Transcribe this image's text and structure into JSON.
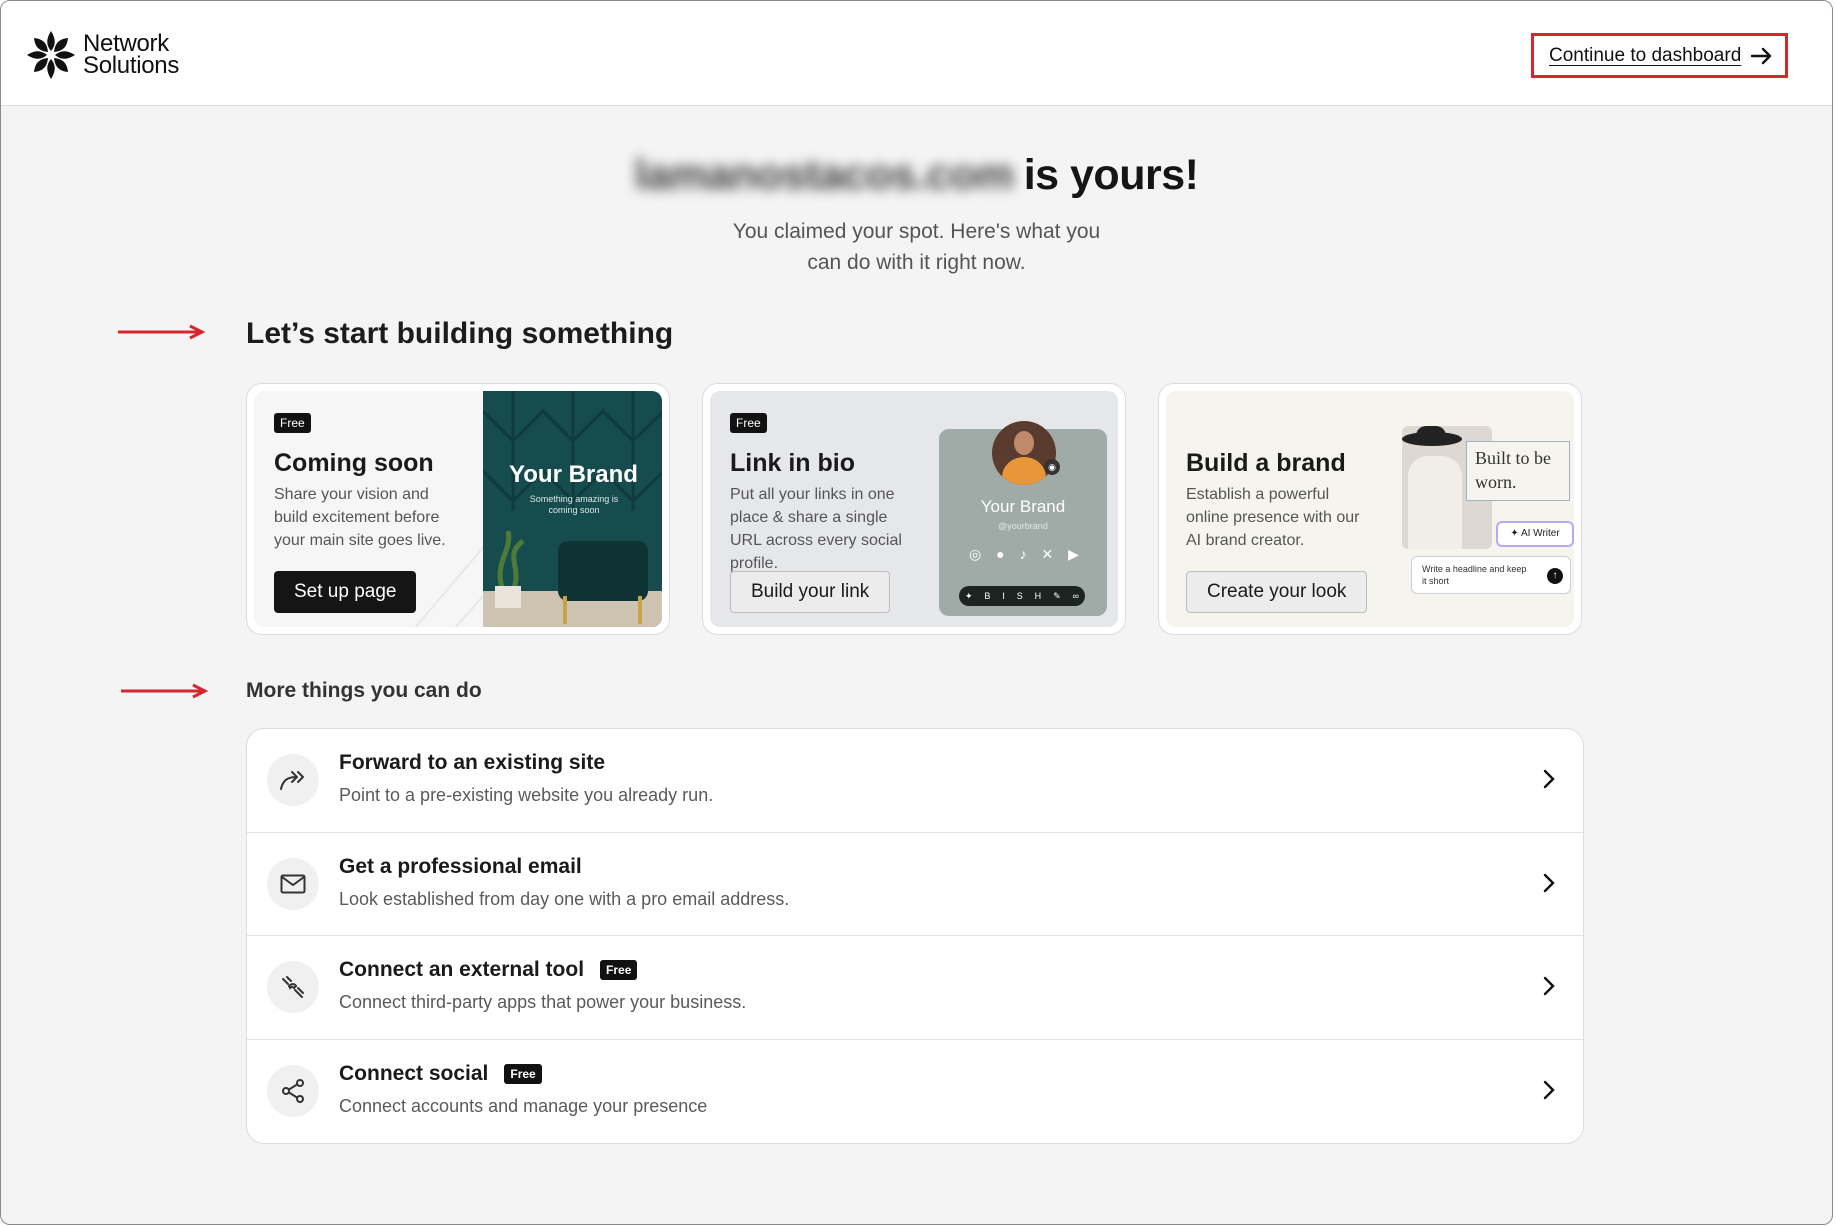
{
  "header": {
    "logo_line1": "Network",
    "logo_line2": "Solutions",
    "continue_label": "Continue to dashboard"
  },
  "hero": {
    "domain": "lamanostacos.com",
    "title_suffix": "is yours!",
    "subtitle": "You claimed your spot. Here's what you can do with it right now."
  },
  "build_section": {
    "title": "Let’s start building something",
    "cards": [
      {
        "badge": "Free",
        "title": "Coming soon",
        "description": "Share your vision and build excitement before your main site goes live.",
        "button": "Set up page",
        "preview_title": "Your Brand",
        "preview_sub": "Something amazing is coming soon"
      },
      {
        "badge": "Free",
        "title": "Link in bio",
        "description": "Put all your links in one place & share a single URL across every social profile.",
        "button": "Build your link",
        "preview_title": "Your Brand",
        "preview_handle": "@yourbrand"
      },
      {
        "title": "Build a brand",
        "description": "Establish a powerful online presence with our AI brand creator.",
        "button": "Create your look",
        "preview_quote": "Built to be worn.",
        "preview_ai": "AI Writer",
        "preview_prompt": "Write a headline and keep it short"
      }
    ]
  },
  "more_section": {
    "title": "More things you can do",
    "items": [
      {
        "icon": "forward-icon",
        "title": "Forward to an existing site",
        "description": "Point to a pre-existing website you already run."
      },
      {
        "icon": "mail-icon",
        "title": "Get a professional email",
        "description": "Look established from day one with a pro email address."
      },
      {
        "icon": "plug-icon",
        "title": "Connect an external tool",
        "badge": "Free",
        "description": "Connect third-party apps that power your business."
      },
      {
        "icon": "share-icon",
        "title": "Connect social",
        "badge": "Free",
        "description": "Connect accounts and manage your presence"
      }
    ]
  },
  "colors": {
    "annotation_red": "#d6262e",
    "dark": "#151515",
    "page_bg": "#f4f4f4"
  }
}
